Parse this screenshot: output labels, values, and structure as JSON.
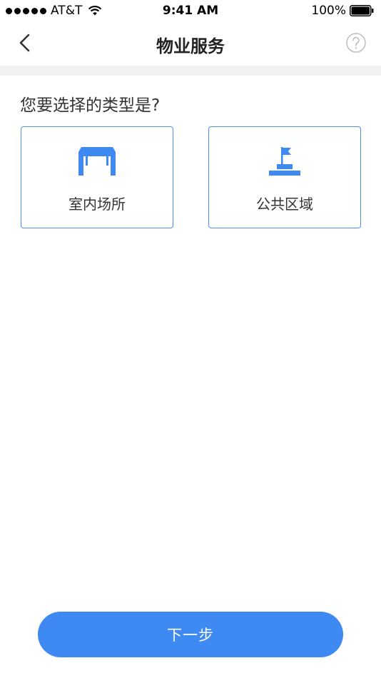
{
  "status_bar": {
    "carrier": "AT&T",
    "time": "9:41 AM",
    "battery": "100%",
    "signal_icon": "signal-dots-icon",
    "wifi_icon": "wifi-icon",
    "battery_icon": "battery-icon"
  },
  "nav": {
    "title": "物业服务",
    "back_icon": "chevron-left-icon",
    "help_icon": "question-circle-icon"
  },
  "main": {
    "question": "您要选择的类型是?",
    "options": [
      {
        "label": "室内场所",
        "icon": "table-icon"
      },
      {
        "label": "公共区域",
        "icon": "flag-podium-icon"
      }
    ],
    "accent_color": "#3f8af2"
  },
  "footer": {
    "next_label": "下一步"
  }
}
